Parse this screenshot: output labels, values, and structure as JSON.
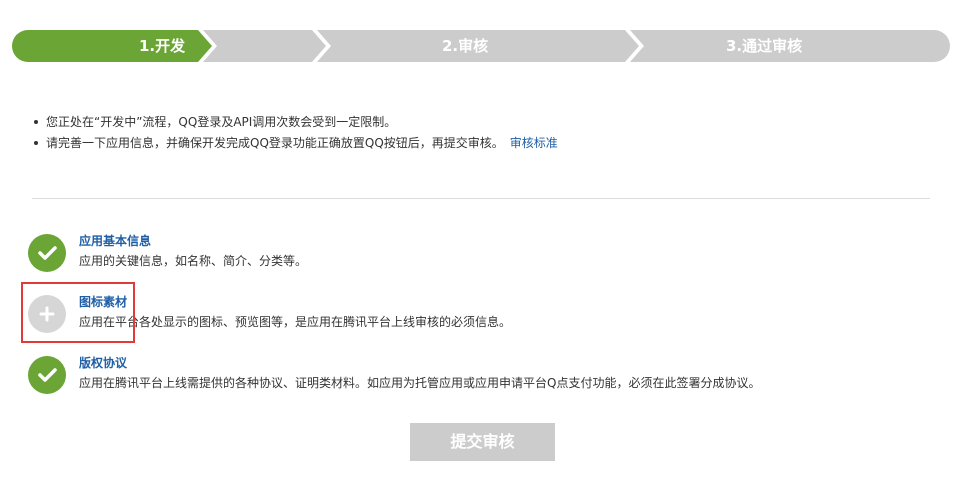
{
  "steps": [
    {
      "label": "1.开发",
      "state": "active"
    },
    {
      "label": "2.审核",
      "state": "inactive"
    },
    {
      "label": "3.通过审核",
      "state": "inactive"
    }
  ],
  "colors": {
    "active_step": "#6aa535",
    "inactive_step": "#cccccc",
    "link": "#1f5fa6",
    "highlight": "#e03a3a"
  },
  "notices": [
    {
      "text": "您正处在“开发中”流程，QQ登录及API调用次数会受到一定限制。"
    },
    {
      "text": "请完善一下应用信息，并确保开发完成QQ登录功能正确放置QQ按钮后，再提交审核。",
      "link": "审核标准"
    }
  ],
  "sections": [
    {
      "title": "应用基本信息",
      "description": "应用的关键信息，如名称、简介、分类等。",
      "status": "complete",
      "icon": "check-icon"
    },
    {
      "title": "图标素材",
      "description": "应用在平台各处显示的图标、预览图等，是应用在腾讯平台上线审核的必须信息。",
      "status": "incomplete",
      "icon": "plus-icon"
    },
    {
      "title": "版权协议",
      "description": "应用在腾讯平台上线需提供的各种协议、证明类材料。如应用为托管应用或应用申请平台Q点支付功能，必须在此签署分成协议。",
      "status": "complete",
      "icon": "check-icon"
    }
  ],
  "submit_label": "提交审核"
}
